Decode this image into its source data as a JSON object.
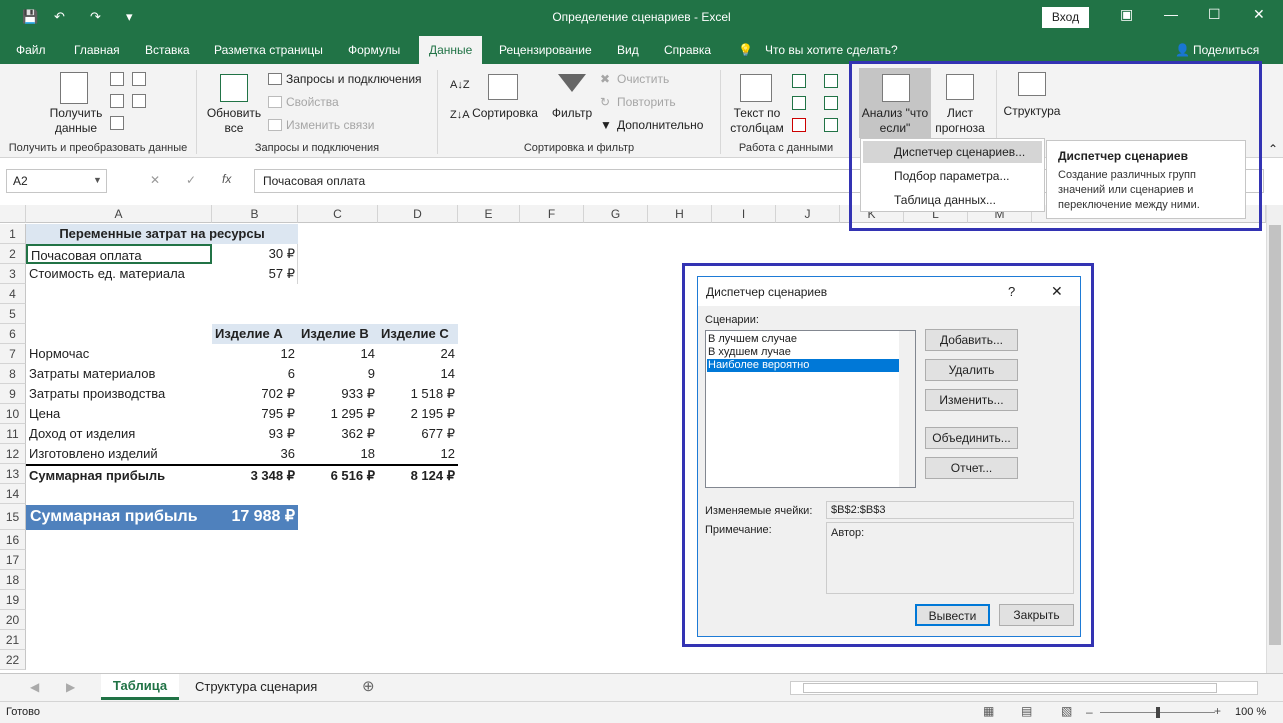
{
  "window": {
    "title": "Определение сценариев - Excel",
    "login_label": "Вход"
  },
  "tabs": [
    "Файл",
    "Главная",
    "Вставка",
    "Разметка страницы",
    "Формулы",
    "Данные",
    "Рецензирование",
    "Вид",
    "Справка"
  ],
  "tell_me": "Что вы хотите сделать?",
  "share": "Поделиться",
  "ribbon": {
    "get_data": "Получить данные",
    "group_get": "Получить и преобразовать данные",
    "refresh_all": "Обновить все",
    "queries": "Запросы и подключения",
    "properties": "Свойства",
    "edit_links": "Изменить связи",
    "group_queries": "Запросы и подключения",
    "sort": "Сортировка",
    "filter": "Фильтр",
    "clear": "Очистить",
    "reapply": "Повторить",
    "advanced": "Дополнительно",
    "group_sort": "Сортировка и фильтр",
    "text_to_columns": "Текст по столбцам",
    "group_data_tools": "Работа с данными",
    "what_if": "Анализ \"что если\"",
    "forecast": "Лист прогноза",
    "outline": "Структура"
  },
  "whatif_menu": [
    "Диспетчер сценариев...",
    "Подбор параметра...",
    "Таблица данных..."
  ],
  "tooltip": {
    "title": "Диспетчер сценариев",
    "body": "Создание различных групп значений или сценариев и переключение между ними."
  },
  "formula_bar": {
    "name_box": "A2",
    "formula": "Почасовая оплата"
  },
  "columns": [
    "A",
    "B",
    "C",
    "D",
    "E",
    "F",
    "G",
    "H",
    "I",
    "J",
    "K",
    "L",
    "M"
  ],
  "rows": [
    "1",
    "2",
    "3",
    "4",
    "5",
    "6",
    "7",
    "8",
    "9",
    "10",
    "11",
    "12",
    "13",
    "14",
    "15",
    "16",
    "17",
    "18",
    "19",
    "20",
    "21",
    "22"
  ],
  "sheet": {
    "a1": "Переменные затрат на ресурсы",
    "a2": "Почасовая оплата",
    "b2": "30 ₽",
    "a3": "Стоимость ед. материала",
    "b3": "57 ₽",
    "headers": [
      "Изделие A",
      "Изделие B",
      "Изделие C"
    ],
    "table": [
      {
        "label": "Нормочас",
        "v": [
          "12",
          "14",
          "24"
        ]
      },
      {
        "label": "Затраты материалов",
        "v": [
          "6",
          "9",
          "14"
        ]
      },
      {
        "label": "Затраты производства",
        "v": [
          "702 ₽",
          "933 ₽",
          "1 518 ₽"
        ]
      },
      {
        "label": "Цена",
        "v": [
          "795 ₽",
          "1 295 ₽",
          "2 195 ₽"
        ]
      },
      {
        "label": "Доход от изделия",
        "v": [
          "93 ₽",
          "362 ₽",
          "677 ₽"
        ]
      },
      {
        "label": "Изготовлено изделий",
        "v": [
          "36",
          "18",
          "12"
        ]
      },
      {
        "label": "Суммарная прибыль",
        "v": [
          "3 348 ₽",
          "6 516 ₽",
          "8 124 ₽"
        ]
      }
    ],
    "total_label": "Суммарная прибыль",
    "total_value": "17 988 ₽"
  },
  "dialog": {
    "title": "Диспетчер сценариев",
    "help": "?",
    "scenarios_label": "Сценарии:",
    "scenarios": [
      "В лучшем случае",
      "В худшем лучае",
      "Наиболее вероятно"
    ],
    "add": "Добавить...",
    "delete": "Удалить",
    "edit": "Изменить...",
    "merge": "Объединить...",
    "report": "Отчет...",
    "changing_label": "Изменяемые ячейки:",
    "changing_value": "$B$2:$B$3",
    "comment_label": "Примечание:",
    "comment_value": "Автор:",
    "show": "Вывести",
    "close": "Закрыть"
  },
  "sheet_tabs": [
    "Таблица",
    "Структура сценария"
  ],
  "status": {
    "ready": "Готово",
    "zoom": "100 %"
  },
  "colors": {
    "excel_green": "#217346",
    "highlight": "#3333b3",
    "total_fill": "#4f81bd",
    "header_fill": "#dce6f1"
  }
}
